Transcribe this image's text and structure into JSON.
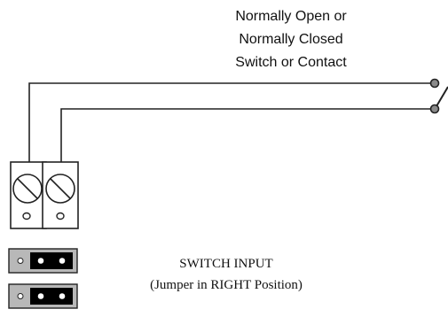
{
  "switch_label": {
    "line1": "Normally Open or",
    "line2": "Normally Closed",
    "line3": "Switch or Contact"
  },
  "input_label": {
    "title": "SWITCH INPUT",
    "note": "(Jumper in RIGHT Position)"
  },
  "colors": {
    "wire": "#222222",
    "terminal_block": "#ffffff",
    "jumper_body": "#b8b8b8",
    "jumper_cap": "#000000"
  }
}
